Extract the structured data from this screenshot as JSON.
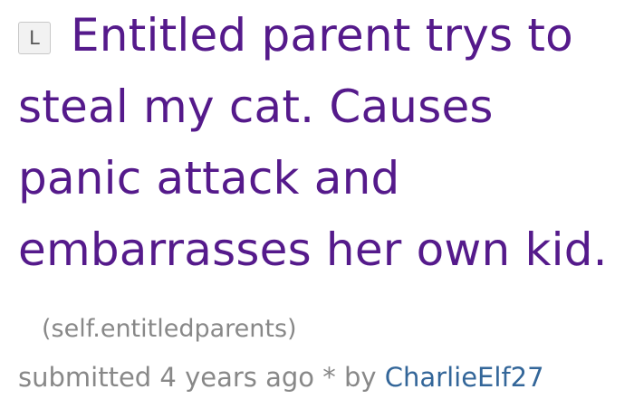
{
  "post": {
    "flair": "L",
    "title": "Entitled parent trys to steal my cat. Causes panic attack and embarrasses her own kid.",
    "domain": "(self.entitledparents)",
    "tagline": {
      "submitted_label": "submitted",
      "time_ago": "4 years ago",
      "separator": "*",
      "by_label": "by",
      "author": "CharlieElf27"
    }
  },
  "colors": {
    "title": "#551a8b",
    "meta": "#888888",
    "author": "#336699",
    "flair_bg": "#f2f2f2",
    "flair_border": "#c8c8c8"
  }
}
